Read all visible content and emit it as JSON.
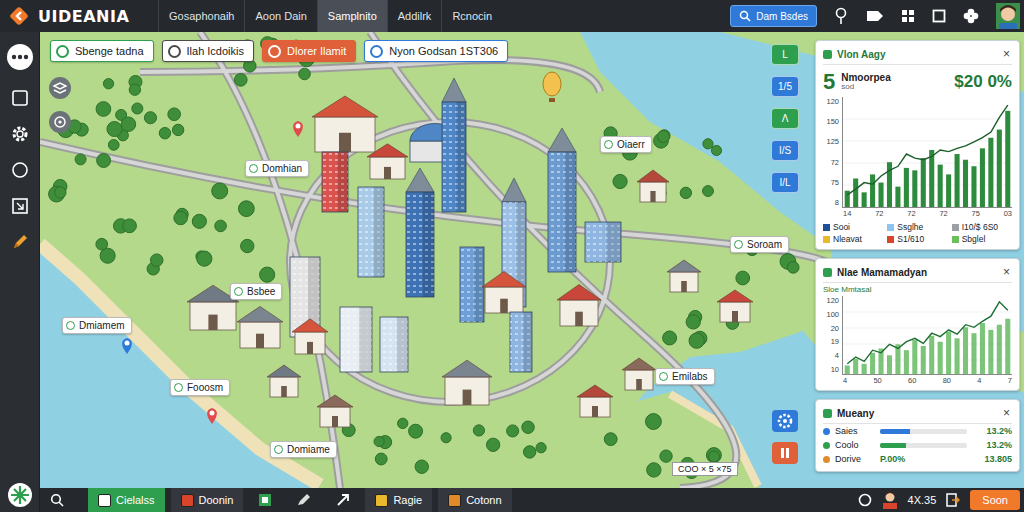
{
  "app": {
    "logo": "UIDEANIA"
  },
  "nav_tabs": [
    {
      "label": "Gosaphonaih",
      "selected": false
    },
    {
      "label": "Aoon Dain",
      "selected": false
    },
    {
      "label": "Samplnito",
      "selected": true
    },
    {
      "label": "Addilrk",
      "selected": false
    },
    {
      "label": "Rcnocin",
      "selected": false
    }
  ],
  "search_button": {
    "label": "Dam Bsdes"
  },
  "filter_chips": [
    {
      "label": "Sbenge tadna",
      "color": "#2e9e4f",
      "kind": "outline"
    },
    {
      "label": "Ilah Icdoikis",
      "color": "#4a4a4a",
      "kind": "outline"
    },
    {
      "label": "Dlorer Ilamit",
      "color": "#e0603a",
      "kind": "filled"
    },
    {
      "label": "Nyon Godsan 1ST306",
      "color": "#2f7ad8",
      "kind": "outline"
    }
  ],
  "map_labels": [
    {
      "label": "Domhian"
    },
    {
      "label": "Oiaerr"
    },
    {
      "label": "Soroam"
    },
    {
      "label": "Bsbee"
    },
    {
      "label": "Dmiamem"
    },
    {
      "label": "Fooosm"
    },
    {
      "label": "Domiame"
    },
    {
      "label": "Emilabs"
    }
  ],
  "map_scale": "COO × 5 ×75",
  "map_tools": [
    {
      "label": "L",
      "color": "#2e9e4f"
    },
    {
      "label": "1/5",
      "color": "#2f7ad8"
    },
    {
      "label": "Λ",
      "color": "#2e9e4f"
    },
    {
      "label": "I/S",
      "color": "#2f7ad8"
    },
    {
      "label": "I/L",
      "color": "#2f7ad8"
    }
  ],
  "sales_card": {
    "title": "Vlon Aagy",
    "close": "×",
    "stat": "5",
    "stat_label": "Nmoorpea",
    "stat_sub": "sod",
    "value": "$20 0%",
    "chart": {
      "y_ticks": [
        "120",
        "150",
        "125",
        "72",
        "75",
        "8"
      ],
      "x_ticks": [
        "14",
        "72",
        "72",
        "72",
        "75",
        "03"
      ],
      "bars": [
        20,
        35,
        18,
        40,
        30,
        55,
        25,
        48,
        45,
        60,
        70,
        52,
        40,
        65,
        58,
        50,
        72,
        85,
        95,
        118
      ],
      "line": [
        15,
        22,
        30,
        28,
        38,
        45,
        50,
        65,
        60,
        58,
        62,
        70,
        68,
        72,
        75,
        80,
        85,
        92,
        110,
        125
      ]
    },
    "legend": [
      {
        "label": "Sooi",
        "color": "#1f4e9a"
      },
      {
        "label": "Ssglhe",
        "color": "#8ec5ef"
      },
      {
        "label": "I10/$ 6S0",
        "color": "#9aa0a6"
      },
      {
        "label": "Nleavat",
        "color": "#e8b92c"
      },
      {
        "label": "S1/610",
        "color": "#d9452b"
      },
      {
        "label": "Sbglel",
        "color": "#6cbf5a"
      }
    ]
  },
  "trend_card": {
    "title": "Nlae Mamamadyan",
    "close": "×",
    "subtitle": "Sloe Mmtasal",
    "chart": {
      "y_ticks": [
        "120",
        "100",
        "20",
        "19",
        "4",
        "10"
      ],
      "x_ticks": [
        "4",
        "50",
        "60",
        "80",
        "4",
        "7"
      ],
      "bars": [
        10,
        18,
        12,
        25,
        30,
        22,
        35,
        28,
        40,
        33,
        45,
        38,
        50,
        42,
        55,
        48,
        60,
        52,
        58,
        65
      ],
      "line": [
        12,
        20,
        15,
        28,
        25,
        35,
        30,
        38,
        42,
        36,
        48,
        44,
        52,
        47,
        58,
        55,
        62,
        68,
        85,
        75
      ]
    }
  },
  "mix_card": {
    "title": "Mueany",
    "close": "×",
    "rows": [
      {
        "name": "Saies",
        "kind": "bar",
        "level": 0.35,
        "reading": "13.2%",
        "color": "#2f7ad8"
      },
      {
        "name": "Coolo",
        "kind": "bar",
        "level": 0.3,
        "reading": "13.2%",
        "color": "#2e9e4f"
      },
      {
        "name": "Dorive",
        "kind": "note",
        "note": "P.00%",
        "reading": "13.805",
        "color": "#e08a2a"
      }
    ]
  },
  "taskbar": {
    "items": [
      {
        "label": "Cielalss",
        "selected": true,
        "color": "#ffffff"
      },
      {
        "label": "Doonin",
        "selected": false,
        "color": "#d9452b"
      },
      {
        "label": "Ragie",
        "selected": false,
        "color": "#e8b92c"
      },
      {
        "label": "Cotonn",
        "selected": false,
        "color": "#e08a2a"
      }
    ],
    "status": "4X.35",
    "action": "Soon"
  }
}
